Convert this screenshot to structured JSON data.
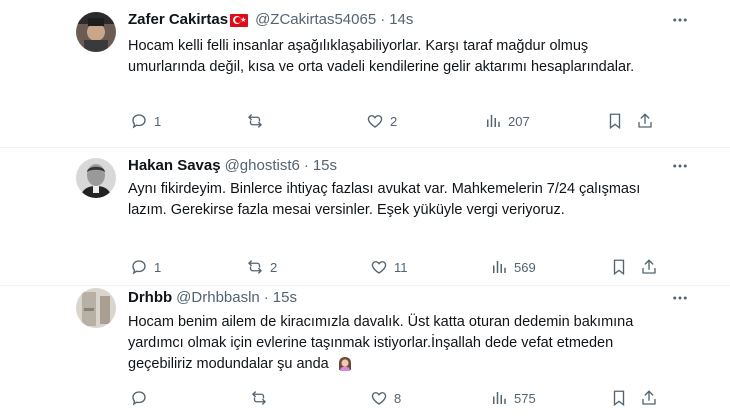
{
  "tweets": [
    {
      "name": "Zafer Cakirtas",
      "handle": "@ZCakirtas54065",
      "dot": "·",
      "time": "14s",
      "text": "Hocam kelli felli insanlar aşağılıklaşabiliyorlar. Karşı taraf mağdur olmuş umurlarında değil, kısa ve orta vadeli kendilerine gelir aktarımı hesaplarındalar.",
      "replies": "1",
      "reposts": "",
      "likes": "2",
      "views": "207"
    },
    {
      "name": "Hakan Savaş",
      "handle": "@ghostist6",
      "dot": "·",
      "time": "15s",
      "text": "Aynı fikirdeyim. Binlerce ihtiyaç fazlası avukat var. Mahkemelerin 7/24 çalışması lazım. Gerekirse fazla mesai versinler. Eşek yüküyle vergi veriyoruz.",
      "replies": "1",
      "reposts": "2",
      "likes": "11",
      "views": "569"
    },
    {
      "name": "Drhbb",
      "handle": "@Drhbbasln",
      "dot": "·",
      "time": "15s",
      "text": "Hocam benim ailem de kiracımızla davalık. Üst katta oturan dedemin bakımına yardımcı olmak için evlerine taşınmak istiyorlar.İnşallah dede vefat etmeden geçebiliriz modundalar şu anda",
      "replies": "",
      "reposts": "",
      "likes": "8",
      "views": "575"
    }
  ],
  "colors": {
    "text": "#0f1419",
    "secondary": "#536471",
    "divider": "#eff3f4",
    "flag": "#e30a17"
  },
  "icons": [
    "more-icon",
    "reply-icon",
    "repost-icon",
    "like-icon",
    "views-icon",
    "bookmark-icon",
    "share-icon",
    "person-emoji-icon",
    "turkey-flag-icon"
  ]
}
